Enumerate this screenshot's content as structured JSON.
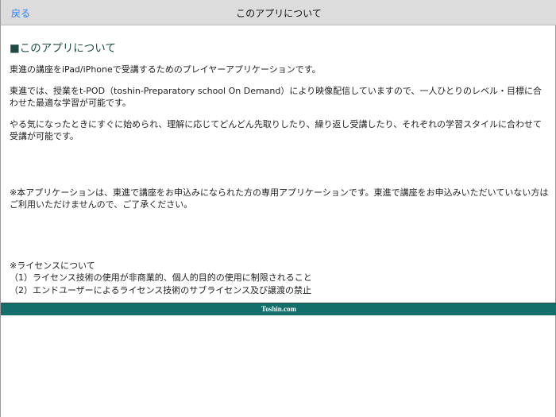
{
  "navbar": {
    "back_label": "戻る",
    "title": "このアプリについて"
  },
  "content": {
    "heading": "■このアプリについて",
    "paragraphs": [
      "東進の講座をiPad/iPhoneで受講するためのプレイヤーアプリケーションです。",
      "東進では、授業をt-POD（toshin-Preparatory school On Demand）により映像配信していますので、一人ひとりのレベル・目標に合わせた最適な学習が可能です。",
      "やる気になったときにすぐに始められ、理解に応じてどんどん先取りしたり、繰り返し受講したり、それぞれの学習スタイルに合わせて受講が可能です。"
    ],
    "notice": "※本アプリケーションは、東進で講座をお申込みになられた方の専用アプリケーションです。東進で講座をお申込みいただいていない方はご利用いただけませんので、ご了承ください。",
    "license": {
      "title": "※ライセンスについて",
      "items": [
        "（1）ライセンス技術の使用が非商業的、個人的目的の使用に制限されること",
        "（2）エンドユーザーによるライセンス技術のサブライセンス及び譲渡の禁止"
      ]
    }
  },
  "footer": {
    "label": "Toshin.com"
  }
}
